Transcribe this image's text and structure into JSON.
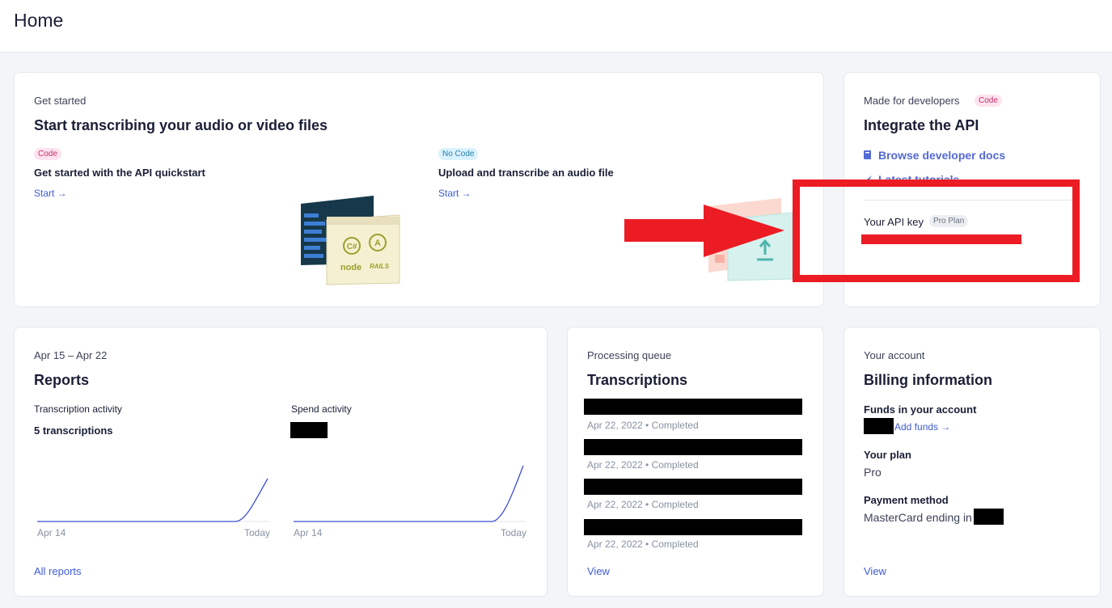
{
  "header": {
    "title": "Home"
  },
  "get_started": {
    "eyebrow": "Get started",
    "title": "Start transcribing your audio or video files",
    "api": {
      "badge": "Code",
      "title": "Get started with the API quickstart",
      "link": "Start →"
    },
    "upload": {
      "badge": "No Code",
      "title": "Upload and transcribe an audio file",
      "link": "Start →"
    },
    "illustration_labels": [
      "C#",
      "A",
      "node",
      "RAILS"
    ]
  },
  "developers": {
    "eyebrow": "Made for developers",
    "badge": "Code",
    "title": "Integrate the API",
    "links": [
      {
        "label": "Browse developer docs",
        "icon": "book-icon"
      },
      {
        "label": "Latest tutorials",
        "icon": "rocket-icon"
      }
    ],
    "api_key_label": "Your API key",
    "plan_badge": "Pro Plan"
  },
  "reports": {
    "eyebrow": "Apr 15 – Apr 22",
    "title": "Reports",
    "transcription": {
      "label": "Transcription activity",
      "value": "5 transcriptions",
      "x_start": "Apr 14",
      "x_end": "Today"
    },
    "spend": {
      "label": "Spend activity",
      "x_start": "Apr 14",
      "x_end": "Today"
    },
    "link": "All reports"
  },
  "queue": {
    "eyebrow": "Processing queue",
    "title": "Transcriptions",
    "items": [
      {
        "status": "Apr 22, 2022 • Completed"
      },
      {
        "status": "Apr 22, 2022 • Completed"
      },
      {
        "status": "Apr 22, 2022 • Completed"
      },
      {
        "status": "Apr 22, 2022 • Completed"
      }
    ],
    "link": "View"
  },
  "account": {
    "eyebrow": "Your account",
    "title": "Billing information",
    "funds_label": "Funds in your account",
    "add_funds": "Add funds →",
    "plan_label": "Your plan",
    "plan_value": "Pro",
    "payment_label": "Payment method",
    "payment_value": "MasterCard ending in",
    "link": "View"
  },
  "colors": {
    "accent": "#5469d4",
    "annotation": "#ec1c24",
    "chart_line": "#3d4fd1"
  }
}
